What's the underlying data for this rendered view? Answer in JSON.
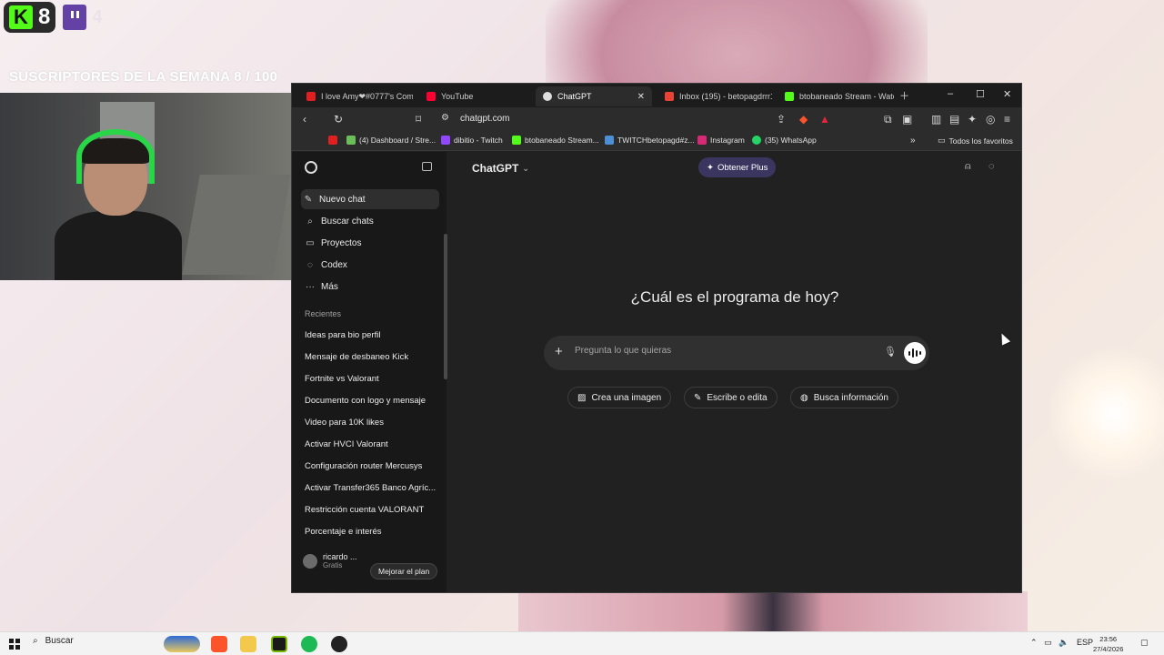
{
  "overlay": {
    "kick_count": "8",
    "twitch_count": "4",
    "subs_banner": "SUSCRIPTORES DE LA SEMANA 8 / 100"
  },
  "browser": {
    "tabs": [
      {
        "label": "I love Amy❤#0777's Comp"
      },
      {
        "label": "YouTube"
      },
      {
        "label": "ChatGPT",
        "active": true
      },
      {
        "label": "Inbox (195) - betopagdrrr1"
      },
      {
        "label": "btobaneado Stream - Watc"
      }
    ],
    "url": "chatgpt.com",
    "bookmarks": [
      {
        "label": "(4) Dashboard / Stre..."
      },
      {
        "label": "dibitio - Twitch"
      },
      {
        "label": "btobaneado Stream..."
      },
      {
        "label": "TWITCHbetopagd#z..."
      },
      {
        "label": "Instagram"
      },
      {
        "label": "(35) WhatsApp"
      }
    ],
    "all_bookmarks": "Todos los favoritos"
  },
  "sidebar": {
    "nav": [
      {
        "label": "Nuevo chat",
        "icon": "edit-icon"
      },
      {
        "label": "Buscar chats",
        "icon": "search-icon"
      },
      {
        "label": "Proyectos",
        "icon": "folder-icon"
      },
      {
        "label": "Codex",
        "icon": "codex-icon"
      },
      {
        "label": "Más",
        "icon": "more-icon"
      }
    ],
    "section_label": "Recientes",
    "recents": [
      "Ideas para bio perfil",
      "Mensaje de desbaneo Kick",
      "Fortnite vs Valorant",
      "Documento con logo y mensaje",
      "Video para 10K likes",
      "Activar HVCI Valorant",
      "Configuración router Mercusys",
      "Activar Transfer365 Banco Agríc...",
      "Restricción cuenta VALORANT",
      "Porcentaje e interés"
    ],
    "user_name": "ricardo ...",
    "user_plan": "Gratis",
    "upgrade_label": "Mejorar el plan"
  },
  "main": {
    "model_label": "ChatGPT",
    "plus_label": "Obtener Plus",
    "headline": "¿Cuál es el programa de hoy?",
    "composer_placeholder": "Pregunta lo que quieras",
    "chips": [
      {
        "label": "Crea una imagen"
      },
      {
        "label": "Escribe o edita"
      },
      {
        "label": "Busca información"
      }
    ]
  },
  "taskbar": {
    "search_label": "Buscar",
    "lang": "ESP",
    "time": "23:56",
    "date": "27/4/2026"
  },
  "colors": {
    "kick_green": "#53fc18",
    "twitch_purple": "#6441a5",
    "chatgpt_bg": "#212121",
    "sidebar_bg": "#181818",
    "plus_button": "#3b3660"
  }
}
